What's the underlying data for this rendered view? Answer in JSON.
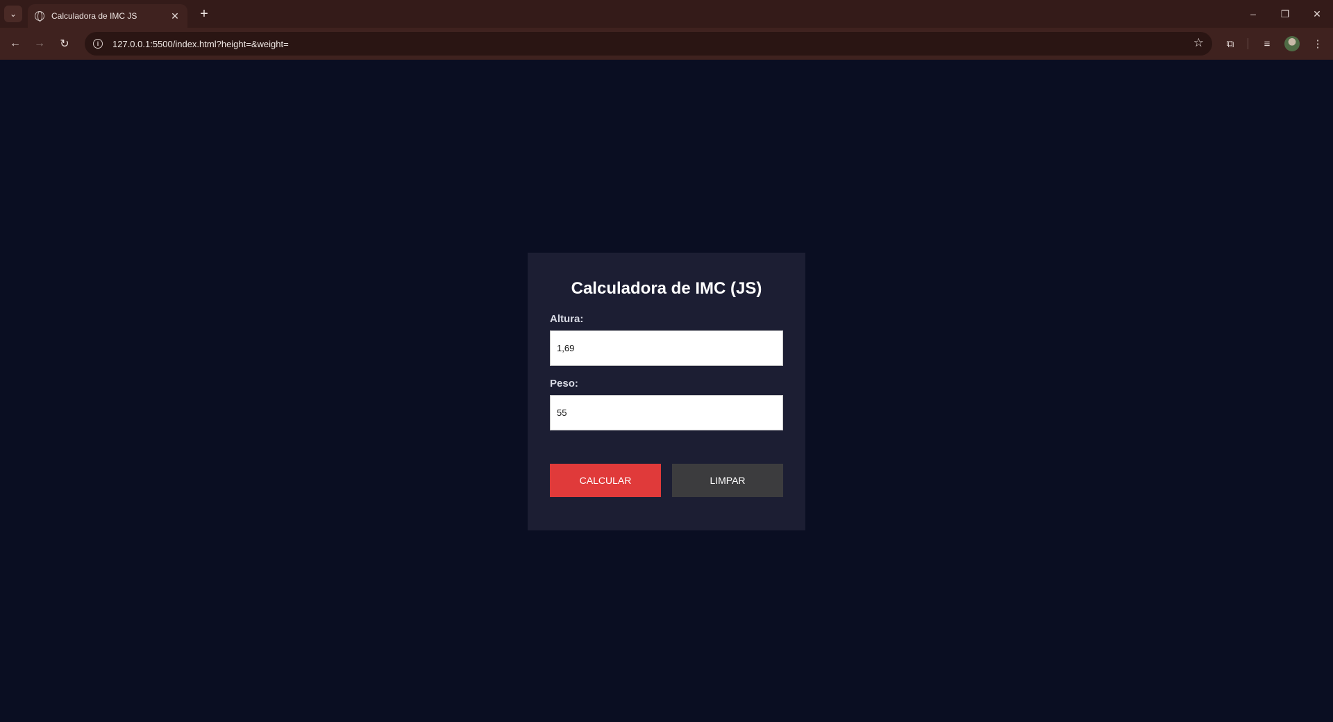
{
  "browser": {
    "tab_title": "Calculadora de IMC JS",
    "url": "127.0.0.1:5500/index.html?height=&weight="
  },
  "form": {
    "title": "Calculadora de IMC (JS)",
    "height_label": "Altura:",
    "height_value": "1,69",
    "weight_label": "Peso:",
    "weight_value": "55",
    "calc_label": "CALCULAR",
    "clear_label": "LIMPAR"
  },
  "colors": {
    "page_bg": "#0a0e22",
    "card_bg": "#1c1e33",
    "calc_button": "#e03a3a",
    "clear_button": "#3c3c3e"
  }
}
